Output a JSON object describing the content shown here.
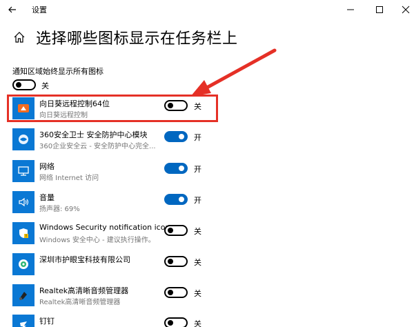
{
  "window": {
    "title": "设置"
  },
  "page": {
    "title": "选择哪些图标显示在任务栏上"
  },
  "always_show": {
    "label": "通知区域始终显示所有图标",
    "state": "关"
  },
  "apps": [
    {
      "name": "向日葵远程控制64位",
      "subtitle": "向日葵远程控制",
      "state": "关",
      "on": false,
      "icon": "sunflower-icon"
    },
    {
      "name": "360安全卫士 安全防护中心模块",
      "subtitle": "360企业安全云 - 安全防护中心完全...",
      "state": "开",
      "on": true,
      "icon": "shield-360-icon"
    },
    {
      "name": "网络",
      "subtitle": "网络 Internet 访问",
      "state": "开",
      "on": true,
      "icon": "network-icon"
    },
    {
      "name": "音量",
      "subtitle": "扬声器: 69%",
      "state": "开",
      "on": true,
      "icon": "speaker-icon"
    },
    {
      "name": "Windows Security notification icon",
      "subtitle": "Windows 安全中心 - 建议执行操作。",
      "state": "关",
      "on": false,
      "icon": "windows-security-icon"
    },
    {
      "name": "深圳市护眼宝科技有限公司",
      "subtitle": "",
      "state": "关",
      "on": false,
      "icon": "eye-protect-icon"
    },
    {
      "name": "Realtek高清晰音频管理器",
      "subtitle": "Realtek高清晰音频管理器",
      "state": "关",
      "on": false,
      "icon": "realtek-audio-icon"
    },
    {
      "name": "钉钉",
      "subtitle": "",
      "state": "关",
      "on": false,
      "icon": "dingtalk-icon"
    }
  ],
  "colors": {
    "accent": "#0067c0",
    "app_icon_bg": "#0a78d4",
    "annotation": "#e53026"
  }
}
